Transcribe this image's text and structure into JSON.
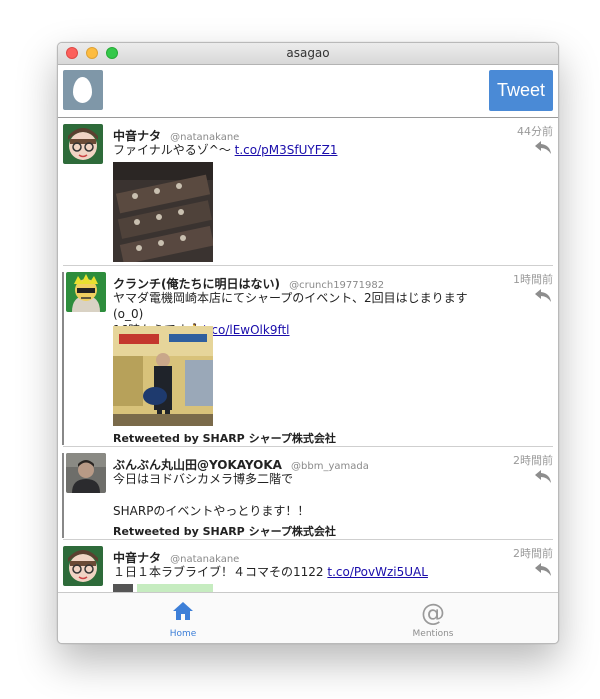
{
  "window": {
    "title": "asagao"
  },
  "toolbar": {
    "tweet_label": "Tweet"
  },
  "tweets": [
    {
      "name": "中音ナタ",
      "handle": "@natanakane",
      "time": "44分前",
      "text": "ファイナルやるゾ^〜 ",
      "link": "t.co/pM3SfUYFZ1"
    },
    {
      "name": "クランチ(俺たちに明日はない)",
      "handle": "@crunch19771982",
      "time": "1時間前",
      "text": "ヤマダ電機岡崎本店にてシャープのイベント、2回目はじまります(o_0)\n16時からです🏃",
      "link": "t.co/lEwOlk9ftl",
      "retweeted_by": "Retweeted by SHARP シャープ株式会社"
    },
    {
      "name": "ぶんぶん丸山田@YOKAYOKA",
      "handle": "@bbm_yamada",
      "time": "2時間前",
      "text": "今日はヨドバシカメラ博多二階で\n\nSHARPのイベントやっとります！！",
      "retweeted_by": "Retweeted by SHARP シャープ株式会社"
    },
    {
      "name": "中音ナタ",
      "handle": "@natanakane",
      "time": "2時間前",
      "text": "１日１本ラブライブ！４コマその1122 ",
      "link": "t.co/PovWzi5UAL"
    }
  ],
  "tabs": {
    "home": "Home",
    "mentions": "Mentions"
  },
  "colors": {
    "accent": "#4a8ad6",
    "tab_active": "#3d7fd8",
    "link": "#1a0dab"
  }
}
